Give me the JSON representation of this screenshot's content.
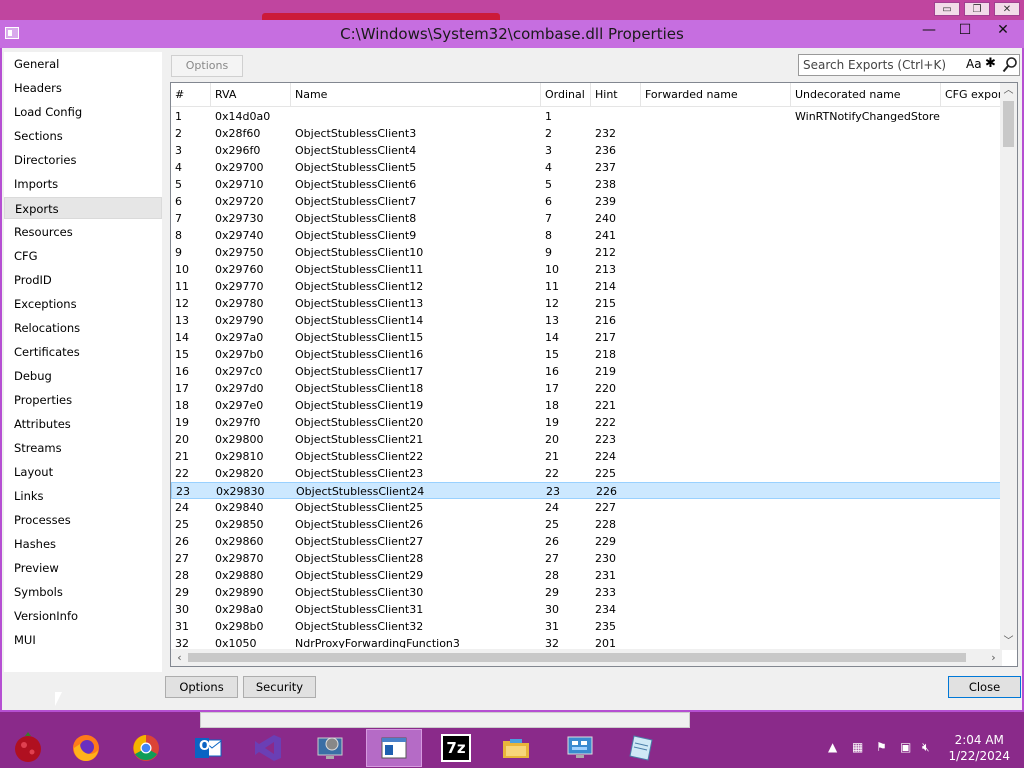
{
  "window": {
    "title": "C:\\Windows\\System32\\combase.dll Properties",
    "min_glyph": "—",
    "max_glyph": "☐",
    "close_glyph": "✕"
  },
  "sidebar": {
    "selected": "Exports",
    "items": [
      "General",
      "Headers",
      "Load Config",
      "Sections",
      "Directories",
      "Imports",
      "Exports",
      "Resources",
      "CFG",
      "ProdID",
      "Exceptions",
      "Relocations",
      "Certificates",
      "Debug",
      "Properties",
      "Attributes",
      "Streams",
      "Layout",
      "Links",
      "Processes",
      "Hashes",
      "Preview",
      "Symbols",
      "VersionInfo",
      "MUI"
    ]
  },
  "toolbar": {
    "options_label": "Options",
    "search_placeholder": "Search Exports (Ctrl+K)",
    "match_case_label": "Aa",
    "regex_label": "✱"
  },
  "table": {
    "columns": [
      "#",
      "RVA",
      "Name",
      "Ordinal",
      "Hint",
      "Forwarded name",
      "Undecorated name",
      "CFG export"
    ],
    "selected_index": 22,
    "rows": [
      [
        "1",
        "0x14d0a0",
        "",
        "1",
        "",
        "",
        "WinRTNotifyChangedStore",
        ""
      ],
      [
        "2",
        "0x28f60",
        "ObjectStublessClient3",
        "2",
        "232",
        "",
        "",
        ""
      ],
      [
        "3",
        "0x296f0",
        "ObjectStublessClient4",
        "3",
        "236",
        "",
        "",
        ""
      ],
      [
        "4",
        "0x29700",
        "ObjectStublessClient5",
        "4",
        "237",
        "",
        "",
        ""
      ],
      [
        "5",
        "0x29710",
        "ObjectStublessClient6",
        "5",
        "238",
        "",
        "",
        ""
      ],
      [
        "6",
        "0x29720",
        "ObjectStublessClient7",
        "6",
        "239",
        "",
        "",
        ""
      ],
      [
        "7",
        "0x29730",
        "ObjectStublessClient8",
        "7",
        "240",
        "",
        "",
        ""
      ],
      [
        "8",
        "0x29740",
        "ObjectStublessClient9",
        "8",
        "241",
        "",
        "",
        ""
      ],
      [
        "9",
        "0x29750",
        "ObjectStublessClient10",
        "9",
        "212",
        "",
        "",
        ""
      ],
      [
        "10",
        "0x29760",
        "ObjectStublessClient11",
        "10",
        "213",
        "",
        "",
        ""
      ],
      [
        "11",
        "0x29770",
        "ObjectStublessClient12",
        "11",
        "214",
        "",
        "",
        ""
      ],
      [
        "12",
        "0x29780",
        "ObjectStublessClient13",
        "12",
        "215",
        "",
        "",
        ""
      ],
      [
        "13",
        "0x29790",
        "ObjectStublessClient14",
        "13",
        "216",
        "",
        "",
        ""
      ],
      [
        "14",
        "0x297a0",
        "ObjectStublessClient15",
        "14",
        "217",
        "",
        "",
        ""
      ],
      [
        "15",
        "0x297b0",
        "ObjectStublessClient16",
        "15",
        "218",
        "",
        "",
        ""
      ],
      [
        "16",
        "0x297c0",
        "ObjectStublessClient17",
        "16",
        "219",
        "",
        "",
        ""
      ],
      [
        "17",
        "0x297d0",
        "ObjectStublessClient18",
        "17",
        "220",
        "",
        "",
        ""
      ],
      [
        "18",
        "0x297e0",
        "ObjectStublessClient19",
        "18",
        "221",
        "",
        "",
        ""
      ],
      [
        "19",
        "0x297f0",
        "ObjectStublessClient20",
        "19",
        "222",
        "",
        "",
        ""
      ],
      [
        "20",
        "0x29800",
        "ObjectStublessClient21",
        "20",
        "223",
        "",
        "",
        ""
      ],
      [
        "21",
        "0x29810",
        "ObjectStublessClient22",
        "21",
        "224",
        "",
        "",
        ""
      ],
      [
        "22",
        "0x29820",
        "ObjectStublessClient23",
        "22",
        "225",
        "",
        "",
        ""
      ],
      [
        "23",
        "0x29830",
        "ObjectStublessClient24",
        "23",
        "226",
        "",
        "",
        ""
      ],
      [
        "24",
        "0x29840",
        "ObjectStublessClient25",
        "24",
        "227",
        "",
        "",
        ""
      ],
      [
        "25",
        "0x29850",
        "ObjectStublessClient26",
        "25",
        "228",
        "",
        "",
        ""
      ],
      [
        "26",
        "0x29860",
        "ObjectStublessClient27",
        "26",
        "229",
        "",
        "",
        ""
      ],
      [
        "27",
        "0x29870",
        "ObjectStublessClient28",
        "27",
        "230",
        "",
        "",
        ""
      ],
      [
        "28",
        "0x29880",
        "ObjectStublessClient29",
        "28",
        "231",
        "",
        "",
        ""
      ],
      [
        "29",
        "0x29890",
        "ObjectStublessClient30",
        "29",
        "233",
        "",
        "",
        ""
      ],
      [
        "30",
        "0x298a0",
        "ObjectStublessClient31",
        "30",
        "234",
        "",
        "",
        ""
      ],
      [
        "31",
        "0x298b0",
        "ObjectStublessClient32",
        "31",
        "235",
        "",
        "",
        ""
      ],
      [
        "32",
        "0x1050",
        "NdrProxyForwardingFunction3",
        "32",
        "201",
        "",
        "",
        ""
      ]
    ]
  },
  "footer": {
    "options_label": "Options",
    "security_label": "Security",
    "close_label": "Close"
  },
  "taskbar": {
    "apps": [
      "start-orb",
      "firefox",
      "chrome",
      "outlook",
      "visual-studio",
      "system-settings",
      "file-properties",
      "7zip",
      "file-explorer",
      "network-control",
      "notepad"
    ],
    "active": "file-properties",
    "time": "2:04 AM",
    "date": "1/22/2024",
    "sevenzip_label": "7z",
    "outlook_label": "O"
  }
}
